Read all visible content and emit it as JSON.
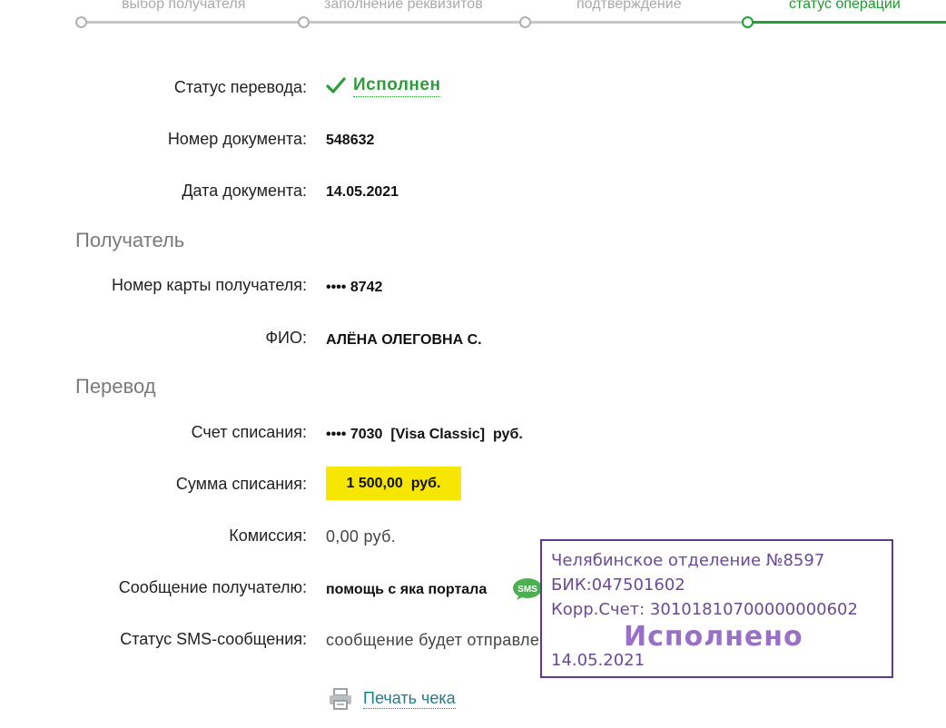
{
  "stepper": {
    "steps": [
      {
        "label": "выбор получателя"
      },
      {
        "label": "заполнение реквизитов"
      },
      {
        "label": "подтверждение"
      },
      {
        "label": "статус операции"
      }
    ]
  },
  "details": {
    "status_label": "Статус перевода:",
    "status_value": "Исполнен",
    "doc_number_label": "Номер документа:",
    "doc_number_value": "548632",
    "doc_date_label": "Дата документа:",
    "doc_date_value": "14.05.2021"
  },
  "recipient": {
    "section_title": "Получатель",
    "card_label": "Номер карты получателя:",
    "card_value": "•••• 8742",
    "name_label": "ФИО:",
    "name_value": "АЛЁНА ОЛЕГОВНА С."
  },
  "transfer": {
    "section_title": "Перевод",
    "account_label": "Счет списания:",
    "account_value": "•••• 7030  [Visa Classic]  руб.",
    "amount_label": "Сумма списания:",
    "amount_value": "1 500,00  руб.",
    "fee_label": "Комиссия:",
    "fee_value": "0,00 руб.",
    "message_label": "Сообщение получателю:",
    "message_value": "помощь с яка портала",
    "sms_status_label": "Статус SMS-сообщения:",
    "sms_status_value": "сообщение будет отправлено",
    "sms_icon_text": "SMS"
  },
  "print": {
    "label": "Печать чека"
  },
  "stamp": {
    "branch": "Челябинское отделение №8597",
    "bik": "БИК:047501602",
    "corr_account": "Корр.Счет: 30101810700000000602",
    "status": "Исполнено",
    "date": "14.05.2021"
  },
  "colors": {
    "accent_green": "#21a038",
    "highlight_yellow": "#f7e600",
    "stamp_purple": "#5e3a8a"
  }
}
